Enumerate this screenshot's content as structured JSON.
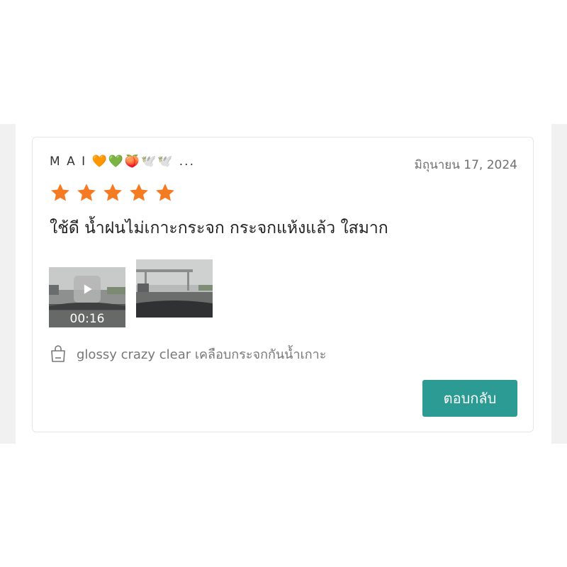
{
  "review": {
    "reviewer_name": "M A I 🧡💚🍑🕊️🕊️ ...",
    "date": "มิถุนายน 17, 2024",
    "rating": 5,
    "rating_max": 5,
    "text": "ใช้ดี น้ำฝนไม่เกาะกระจก กระจกแห้งแล้ว ใสมาก",
    "video_duration": "00:16",
    "product_name": "glossy crazy clear เคลือบกระจกกันน้ำเกาะ",
    "reply_label": "ตอบกลับ"
  },
  "colors": {
    "star": "#f57b22",
    "reply_button": "#2b9b93",
    "text_primary": "#222222",
    "text_muted": "#777777"
  },
  "icons": {
    "star": "star-icon",
    "play": "play-icon",
    "product": "shopping-bag-icon"
  }
}
